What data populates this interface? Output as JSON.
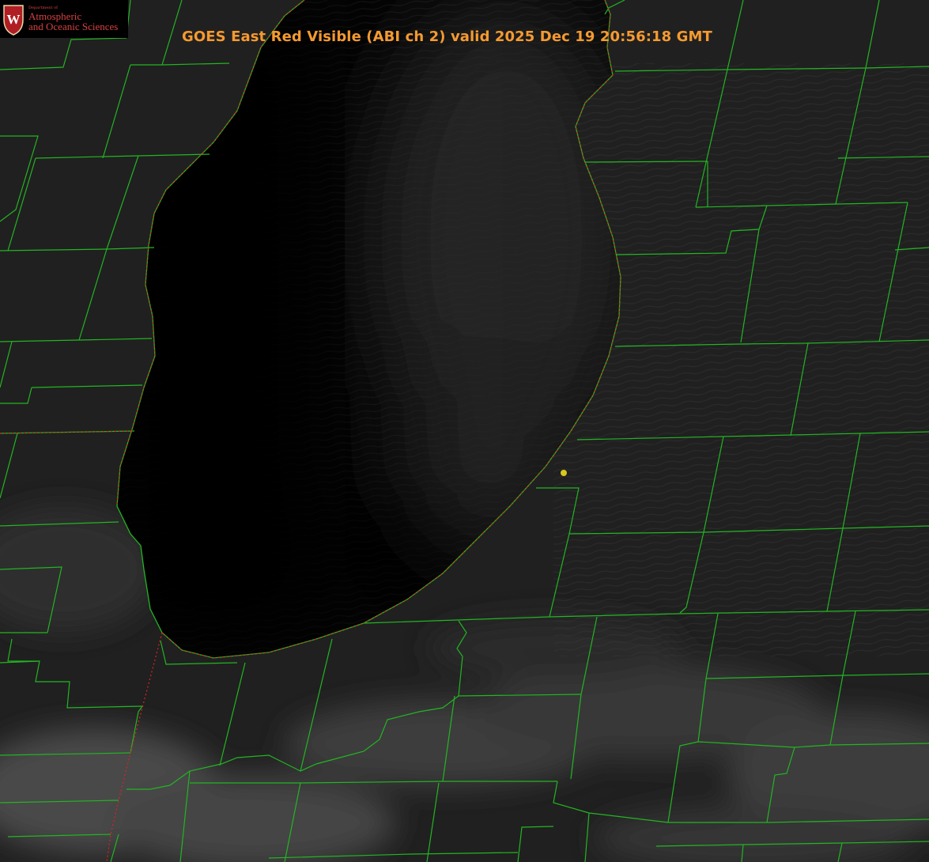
{
  "logo": {
    "dept_label": "Department of",
    "line1": "Atmospheric",
    "line2": "and Oceanic Sciences",
    "seal_icon": "uw-crest-icon",
    "seal_letter": "W"
  },
  "title": "GOES East Red Visible (ABI ch 2) valid 2025 Dec 19 20:56:18 GMT",
  "colors": {
    "title": "#f59a30",
    "county_lines": "#22b522",
    "state_border": "#e02020",
    "marker": "#d6c81e",
    "logo_text": "#d94040",
    "logo_seal": "#b01e23"
  },
  "map": {
    "feature": "lake-shoreline",
    "marker_icon": "location-dot-icon"
  }
}
